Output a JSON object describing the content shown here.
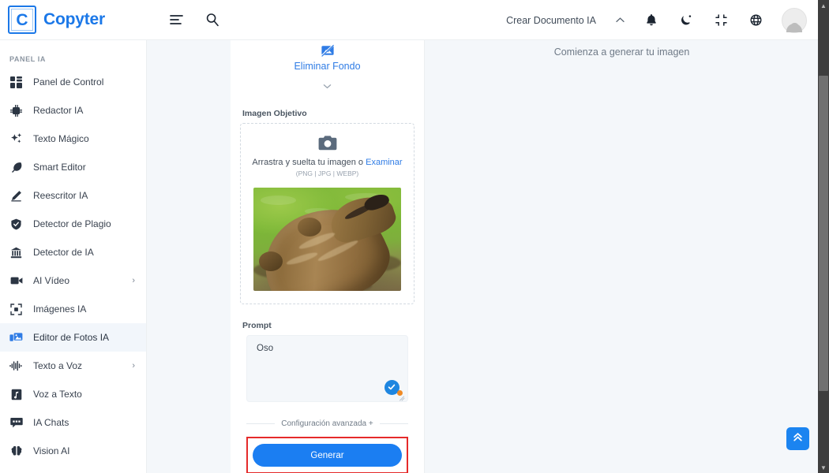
{
  "header": {
    "brand_initial": "C",
    "brand_name": "Copyter",
    "menu_icon": "menu-lines-icon",
    "search_icon": "search-icon",
    "create_doc_label": "Crear Documento IA",
    "collapse_icon": "chevron-up-icon",
    "notifications_icon": "bell-icon",
    "theme_icon": "moon-icon",
    "fullscreen_icon": "compress-icon",
    "language_icon": "globe-icon",
    "avatar_icon": "user-avatar-icon"
  },
  "sidebar": {
    "section_title": "PANEL IA",
    "items": [
      {
        "label": "Panel de Control",
        "icon": "dashboard-icon",
        "active": false,
        "submenu": false
      },
      {
        "label": "Redactor IA",
        "icon": "chip-ai-icon",
        "active": false,
        "submenu": false
      },
      {
        "label": "Texto Mágico",
        "icon": "sparkles-icon",
        "active": false,
        "submenu": false
      },
      {
        "label": "Smart Editor",
        "icon": "feather-icon",
        "active": false,
        "submenu": false
      },
      {
        "label": "Reescritor IA",
        "icon": "pencil-icon",
        "active": false,
        "submenu": false
      },
      {
        "label": "Detector de Plagio",
        "icon": "shield-check-icon",
        "active": false,
        "submenu": false
      },
      {
        "label": "Detector de IA",
        "icon": "bank-detector-icon",
        "active": false,
        "submenu": false
      },
      {
        "label": "AI Vídeo",
        "icon": "video-camera-icon",
        "active": false,
        "submenu": true
      },
      {
        "label": "Imágenes IA",
        "icon": "image-frame-icon",
        "active": false,
        "submenu": false
      },
      {
        "label": "Editor de Fotos IA",
        "icon": "photo-editor-icon",
        "active": true,
        "submenu": false
      },
      {
        "label": "Texto a Voz",
        "icon": "waveform-icon",
        "active": false,
        "submenu": true
      },
      {
        "label": "Voz a Texto",
        "icon": "audio-file-icon",
        "active": false,
        "submenu": false
      },
      {
        "label": "IA Chats",
        "icon": "chat-bubble-icon",
        "active": false,
        "submenu": false
      },
      {
        "label": "Vision AI",
        "icon": "brain-icon",
        "active": false,
        "submenu": false
      }
    ],
    "submenu_arrow": "›"
  },
  "panel": {
    "tool_tab": {
      "label": "Eliminar Fondo",
      "icon": "image-slash-icon"
    },
    "tab_chevron": "chevron-down-icon",
    "target_image": {
      "label": "Imagen Objetivo",
      "dropzone_icon": "camera-icon",
      "dropzone_text": "Arrastra y suelta tu imagen o ",
      "dropzone_link": "Examinar",
      "dropzone_formats": "(PNG | JPG | WEBP)",
      "thumbnail_alt": "brown-bear-on-grass-photo"
    },
    "prompt": {
      "label": "Prompt",
      "value": "Oso",
      "placeholder": "",
      "badge_icon": "grammarly-check-icon",
      "resize_handle": "resize-grip-icon"
    },
    "advanced_settings_label": "Configuración avanzada +",
    "generate_button": "Generar",
    "highlight_color": "#e52a2a"
  },
  "preview": {
    "message": "Comienza a generar tu imagen"
  },
  "fab": {
    "label": "scroll-to-top",
    "icon": "double-chevron-up-icon",
    "color": "#1b84f0"
  },
  "colors": {
    "brand_blue": "#1b78e8",
    "accent_blue": "#2f7ce5",
    "button_blue": "#1b7ef2",
    "panel_bg": "#f4f7fa",
    "card_bg": "#ffffff",
    "text_dark": "#2b3543"
  },
  "scrollbar": {
    "vertical_up_arrow": "▲",
    "vertical_down_arrow": "▼"
  }
}
